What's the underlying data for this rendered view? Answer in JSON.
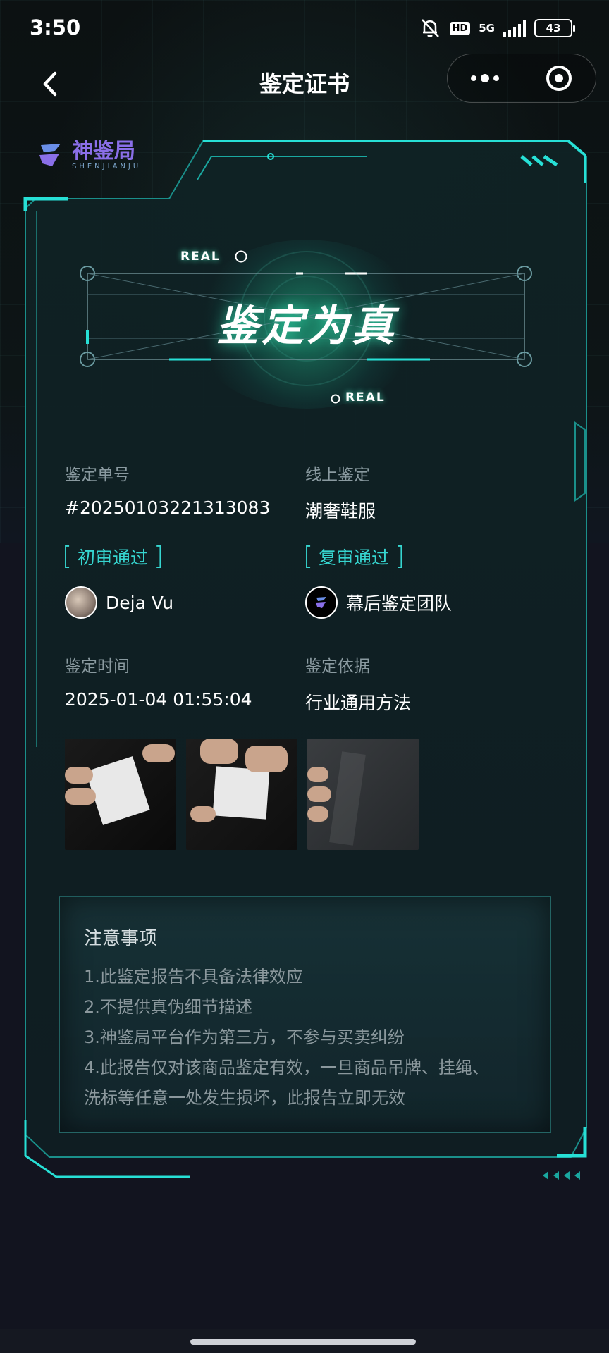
{
  "status_bar": {
    "time": "3:50",
    "hd": "HD",
    "network": "5G",
    "battery": "43"
  },
  "nav": {
    "title": "鉴定证书"
  },
  "logo": {
    "name": "神鉴局",
    "subtitle": "SHENJIANJU"
  },
  "banner": {
    "title": "鉴定为真",
    "tag_top": "REAL",
    "tag_bottom": "REAL"
  },
  "details": {
    "order_label": "鉴定单号",
    "order_value": "#20250103221313083",
    "type_label": "线上鉴定",
    "type_value": "潮奢鞋服",
    "first_review": "初审通过",
    "first_reviewer": "Deja Vu",
    "second_review": "复审通过",
    "second_reviewer": "幕后鉴定团队",
    "time_label": "鉴定时间",
    "time_value": "2025-01-04 01:55:04",
    "basis_label": "鉴定依据",
    "basis_value": "行业通用方法"
  },
  "photos": [
    "care-label-photo-1",
    "care-label-photo-2",
    "embroidery-photo-3"
  ],
  "notes": {
    "title": "注意事项",
    "lines": [
      "1.此鉴定报告不具备法律效应",
      "2.不提供真伪细节描述",
      "3.神鉴局平台作为第三方，不参与买卖纠纷",
      "4.此报告仅对该商品鉴定有效，一旦商品吊牌、挂绳、",
      "洗标等任意一处发生损坏，此报告立即无效"
    ]
  },
  "colors": {
    "accent": "#36d6d0",
    "frame": "#27e0d6",
    "logo": "#8a6fe8",
    "background": "#12141f"
  },
  "icons": {
    "back": "chevron-left-icon",
    "more": "more-dots-icon",
    "close": "target-circle-icon",
    "mute": "bell-off-icon"
  }
}
